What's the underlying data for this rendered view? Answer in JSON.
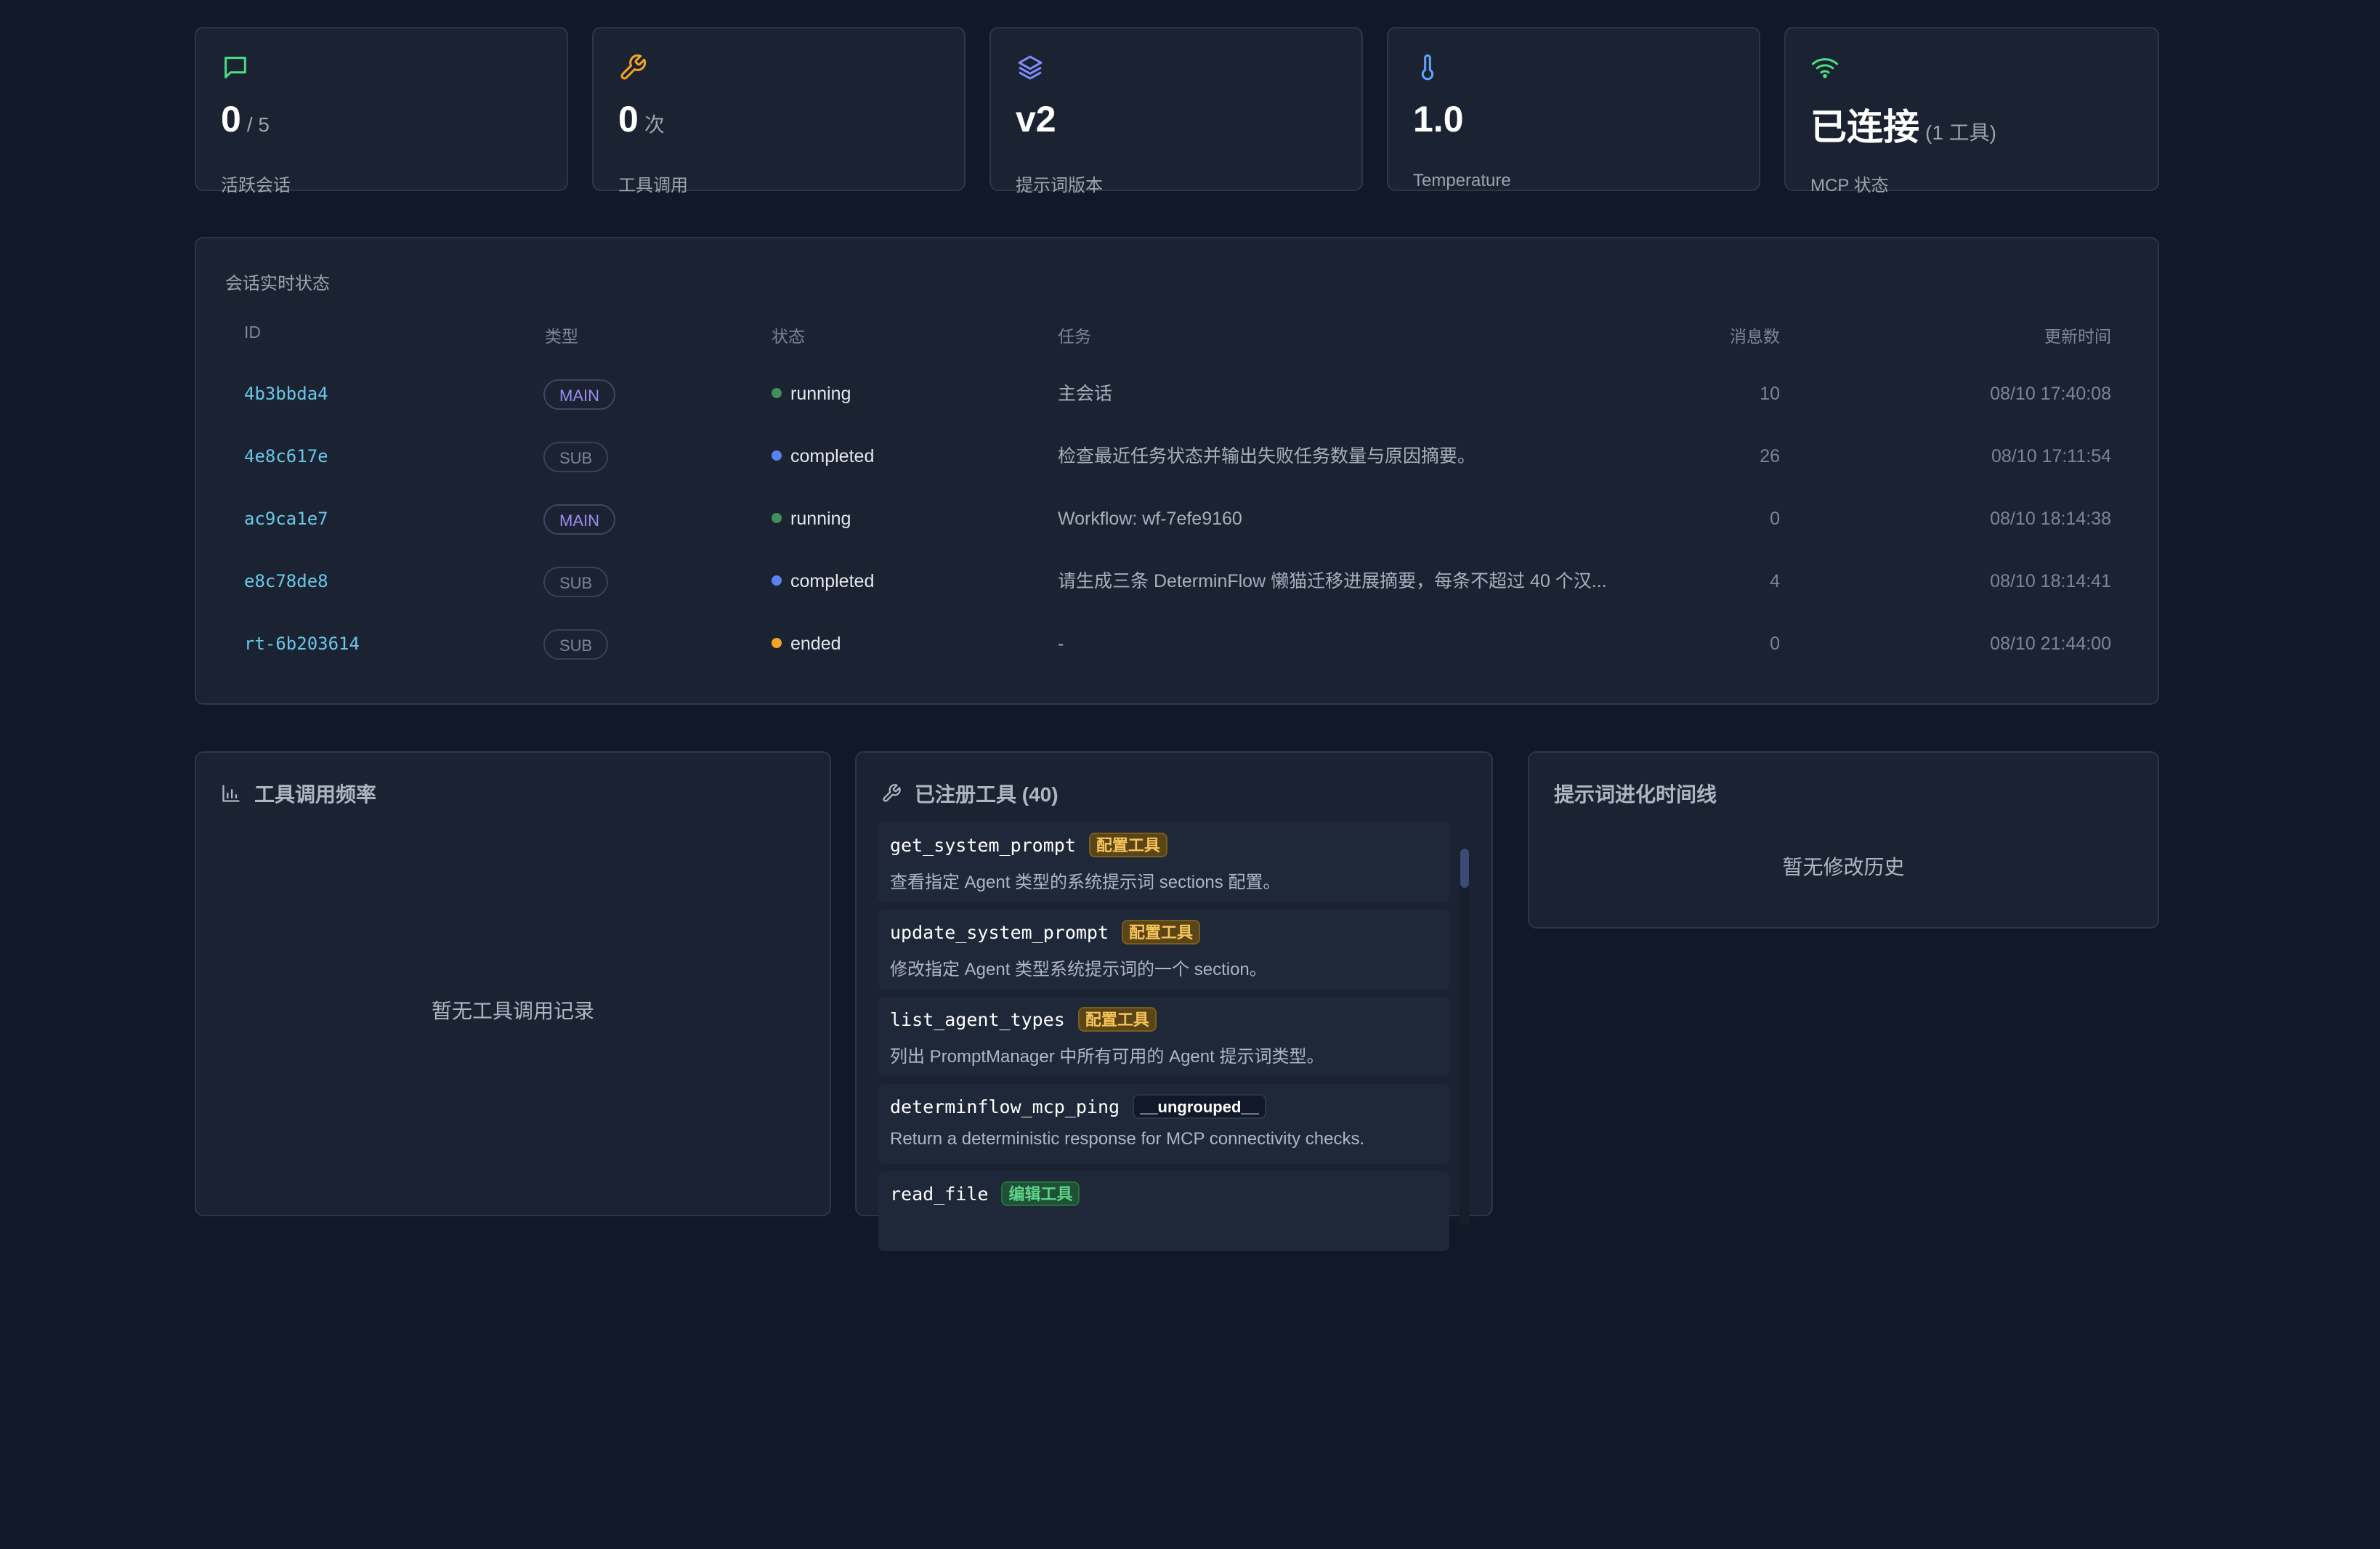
{
  "stats": [
    {
      "icon": "message-icon",
      "value": "0",
      "unit": "/ 5",
      "label": "活跃会话",
      "color": "#4ade80"
    },
    {
      "icon": "wrench-icon",
      "value": "0",
      "unit": "次",
      "label": "工具调用",
      "color": "#f5a524"
    },
    {
      "icon": "layers-icon",
      "value": "v2",
      "unit": "",
      "label": "提示词版本",
      "color": "#818cf8"
    },
    {
      "icon": "thermometer-icon",
      "value": "1.0",
      "unit": "",
      "label": "Temperature",
      "color": "#60a5fa"
    },
    {
      "icon": "wifi-icon",
      "value": "已连接",
      "unit": "(1 工具)",
      "label": "MCP 状态",
      "color": "#4ade80"
    }
  ],
  "sessions": {
    "title": "会话实时状态",
    "headers": {
      "id": "ID",
      "type": "类型",
      "status": "状态",
      "task": "任务",
      "messages": "消息数",
      "updated": "更新时间"
    },
    "rows": [
      {
        "id": "4b3bbda4",
        "type": "MAIN",
        "status": "running",
        "status_color": "#3f8f5a",
        "task": "主会话",
        "messages": "10",
        "updated": "08/10 17:40:08"
      },
      {
        "id": "4e8c617e",
        "type": "SUB",
        "status": "completed",
        "status_color": "#5b82f0",
        "task": "检查最近任务状态并输出失败任务数量与原因摘要。",
        "messages": "26",
        "updated": "08/10 17:11:54"
      },
      {
        "id": "ac9ca1e7",
        "type": "MAIN",
        "status": "running",
        "status_color": "#3f8f5a",
        "task": "Workflow: wf-7efe9160",
        "messages": "0",
        "updated": "08/10 18:14:38"
      },
      {
        "id": "e8c78de8",
        "type": "SUB",
        "status": "completed",
        "status_color": "#5b82f0",
        "task": "请生成三条 DeterminFlow 懒猫迁移进展摘要，每条不超过 40 个汉...",
        "messages": "4",
        "updated": "08/10 18:14:41"
      },
      {
        "id": "rt-6b203614",
        "type": "SUB",
        "status": "ended",
        "status_color": "#f5a524",
        "task": "-",
        "messages": "0",
        "updated": "08/10 21:44:00"
      }
    ]
  },
  "tool_freq": {
    "title": "工具调用频率",
    "icon": "bar-chart-icon",
    "empty": "暂无工具调用记录"
  },
  "registered": {
    "title": "已注册工具 (40)",
    "icon": "wrench-icon",
    "tools": [
      {
        "name": "get_system_prompt",
        "tag": "配置工具",
        "tag_type": "config",
        "desc": "查看指定 Agent 类型的系统提示词 sections 配置。"
      },
      {
        "name": "update_system_prompt",
        "tag": "配置工具",
        "tag_type": "config",
        "desc": "修改指定 Agent 类型系统提示词的一个 section。"
      },
      {
        "name": "list_agent_types",
        "tag": "配置工具",
        "tag_type": "config",
        "desc": "列出 PromptManager 中所有可用的 Agent 提示词类型。"
      },
      {
        "name": "determinflow_mcp_ping",
        "tag": "__ungrouped__",
        "tag_type": "plain",
        "desc": "Return a deterministic response for MCP connectivity checks."
      },
      {
        "name": "read_file",
        "tag": "编辑工具",
        "tag_type": "edit",
        "desc": ""
      }
    ]
  },
  "timeline": {
    "title": "提示词进化时间线",
    "empty": "暂无修改历史"
  }
}
